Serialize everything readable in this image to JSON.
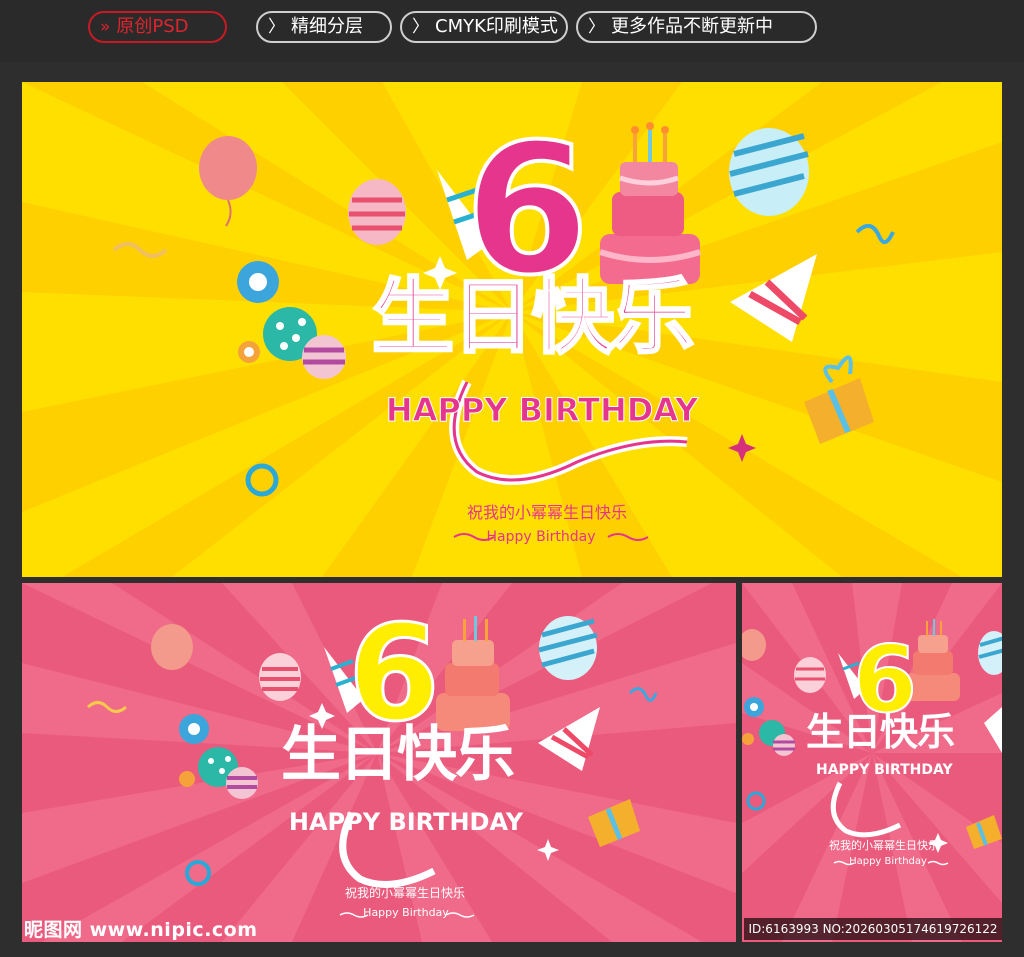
{
  "topbar": {
    "badges": [
      {
        "label": "原创PSD"
      },
      {
        "label": "精细分层"
      },
      {
        "label": "CMYK印刷模式"
      },
      {
        "label": "更多作品不断更新中"
      }
    ]
  },
  "banner": {
    "number": "6",
    "title_cn": "生日快乐",
    "title_en": "HAPPY BIRTHDAY",
    "subtitle_cn": "祝我的小幂幂生日快乐",
    "subtitle_en": "Happy Birthday"
  },
  "colors": {
    "yellow_bg": "#ffdf00",
    "pink_bg": "#ea5a7d",
    "magenta": "#e6358c",
    "white": "#ffffff",
    "badge_red": "#c81a24"
  },
  "watermark": {
    "left": "昵图网 www.nipic.com",
    "right": "ID:6163993 NO:20260305174619726122"
  }
}
